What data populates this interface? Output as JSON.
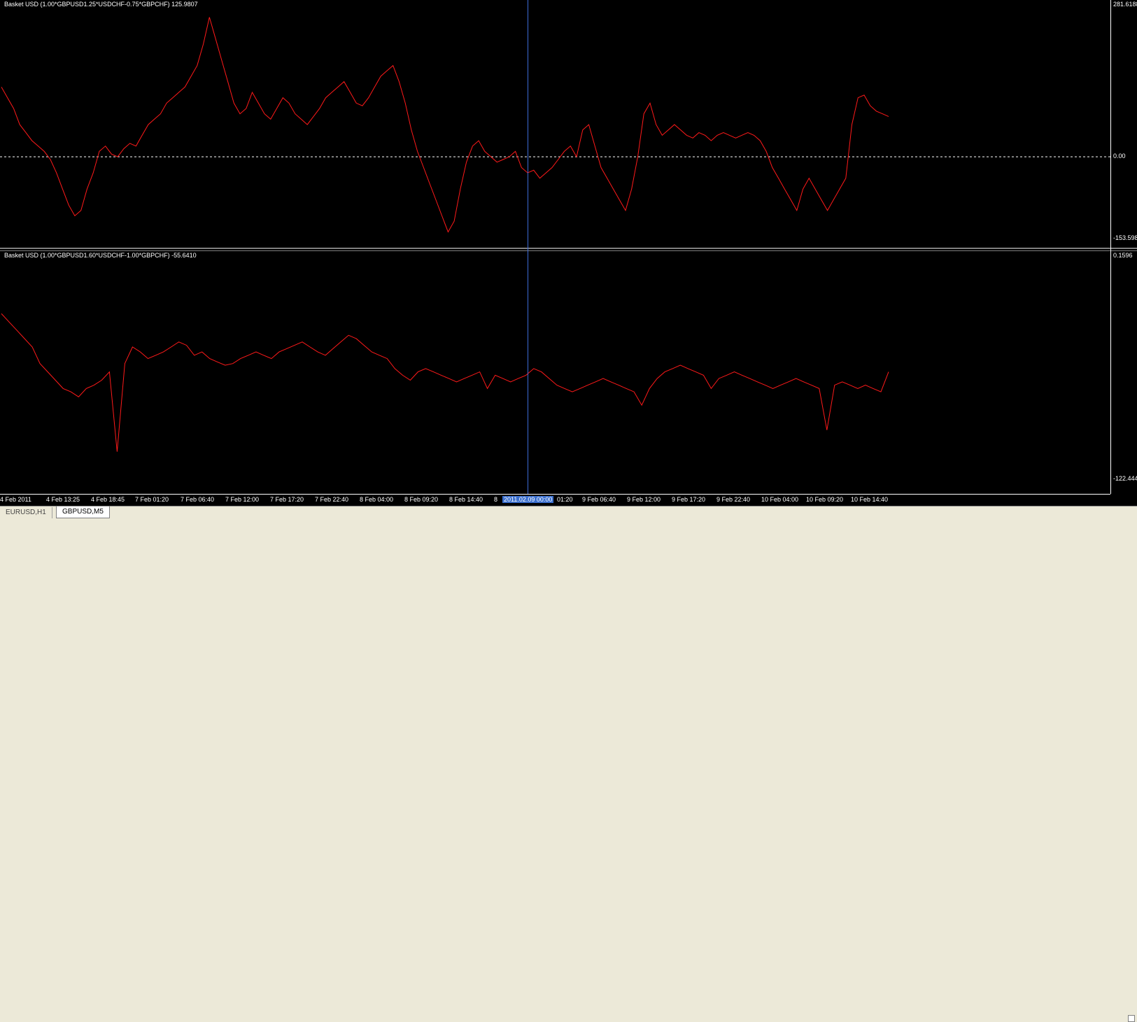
{
  "panes": [
    {
      "title": "Basket USD (1.00*GBPUSD1.25*USDCHF-0.75*GBPCHF) 125.9807",
      "scale_max": "281.6188",
      "scale_zero": "0.00",
      "scale_min": "-153.5985",
      "line_color": "#ff1a1a",
      "zero_line_color": "#ffffff",
      "series": [
        130,
        110,
        90,
        60,
        45,
        30,
        20,
        10,
        -5,
        -30,
        -60,
        -90,
        -110,
        -100,
        -60,
        -30,
        10,
        20,
        5,
        0,
        15,
        25,
        20,
        40,
        60,
        70,
        80,
        100,
        110,
        120,
        130,
        150,
        170,
        210,
        260,
        220,
        180,
        140,
        100,
        80,
        90,
        120,
        100,
        80,
        70,
        90,
        110,
        100,
        80,
        70,
        60,
        75,
        90,
        110,
        120,
        130,
        140,
        120,
        100,
        95,
        110,
        130,
        150,
        160,
        170,
        140,
        100,
        50,
        10,
        -20,
        -50,
        -80,
        -110,
        -140,
        -120,
        -60,
        -10,
        20,
        30,
        10,
        0,
        -10,
        -5,
        0,
        10,
        -20,
        -30,
        -25,
        -40,
        -30,
        -20,
        -5,
        10,
        20,
        0,
        50,
        60,
        20,
        -20,
        -40,
        -60,
        -80,
        -100,
        -60,
        0,
        80,
        100,
        60,
        40,
        50,
        60,
        50,
        40,
        35,
        45,
        40,
        30,
        40,
        45,
        40,
        35,
        40,
        45,
        40,
        30,
        10,
        -20,
        -40,
        -60,
        -80,
        -100,
        -60,
        -40,
        -60,
        -80,
        -100,
        -80,
        -60,
        -40,
        60,
        110,
        115,
        95,
        85,
        80,
        75
      ]
    },
    {
      "title": "Basket USD (1.00*GBPUSD1.60*USDCHF-1.00*GBPCHF) -55.6410",
      "scale_max": "0.1596",
      "scale_min": "-122.4445",
      "line_color": "#ff1a1a",
      "series": [
        -25,
        -30,
        -35,
        -40,
        -45,
        -55,
        -60,
        -65,
        -70,
        -72,
        -75,
        -70,
        -68,
        -65,
        -60,
        -108,
        -55,
        -45,
        -48,
        -52,
        -50,
        -48,
        -45,
        -42,
        -44,
        -50,
        -48,
        -52,
        -54,
        -56,
        -55,
        -52,
        -50,
        -48,
        -50,
        -52,
        -48,
        -46,
        -44,
        -42,
        -45,
        -48,
        -50,
        -46,
        -42,
        -38,
        -40,
        -44,
        -48,
        -50,
        -52,
        -58,
        -62,
        -65,
        -60,
        -58,
        -60,
        -62,
        -64,
        -66,
        -64,
        -62,
        -60,
        -70,
        -62,
        -64,
        -66,
        -64,
        -62,
        -58,
        -60,
        -64,
        -68,
        -70,
        -72,
        -70,
        -68,
        -66,
        -64,
        -66,
        -68,
        -70,
        -72,
        -80,
        -70,
        -64,
        -60,
        -58,
        -56,
        -58,
        -60,
        -62,
        -70,
        -64,
        -62,
        -60,
        -62,
        -64,
        -66,
        -68,
        -70,
        -68,
        -66,
        -64,
        -66,
        -68,
        -70,
        -95,
        -68,
        -66,
        -68,
        -70,
        -68,
        -70,
        -72,
        -60
      ]
    }
  ],
  "xaxis": {
    "labels": [
      {
        "text": "4 Feb 2011",
        "cursor": false
      },
      {
        "text": "4 Feb 13:25",
        "cursor": false
      },
      {
        "text": "4 Feb 18:45",
        "cursor": false
      },
      {
        "text": "7 Feb 01:20",
        "cursor": false
      },
      {
        "text": "7 Feb 06:40",
        "cursor": false
      },
      {
        "text": "7 Feb 12:00",
        "cursor": false
      },
      {
        "text": "7 Feb 17:20",
        "cursor": false
      },
      {
        "text": "7 Feb 22:40",
        "cursor": false
      },
      {
        "text": "8 Feb 04:00",
        "cursor": false
      },
      {
        "text": "8 Feb 09:20",
        "cursor": false
      },
      {
        "text": "8 Feb 14:40",
        "cursor": false
      },
      {
        "text": "8",
        "cursor": false
      },
      {
        "text": "2011.02.09 00:00",
        "cursor": true
      },
      {
        "text": "01:20",
        "cursor": false
      },
      {
        "text": "9 Feb 06:40",
        "cursor": false
      },
      {
        "text": "9 Feb 12:00",
        "cursor": false
      },
      {
        "text": "9 Feb 17:20",
        "cursor": false
      },
      {
        "text": "9 Feb 22:40",
        "cursor": false
      },
      {
        "text": "10 Feb 04:00",
        "cursor": false
      },
      {
        "text": "10 Feb 09:20",
        "cursor": false
      },
      {
        "text": "10 Feb 14:40",
        "cursor": false
      }
    ]
  },
  "tabs": [
    {
      "label": "EURUSD,H1",
      "active": false
    },
    {
      "label": "GBPUSD,M5",
      "active": true
    }
  ]
}
